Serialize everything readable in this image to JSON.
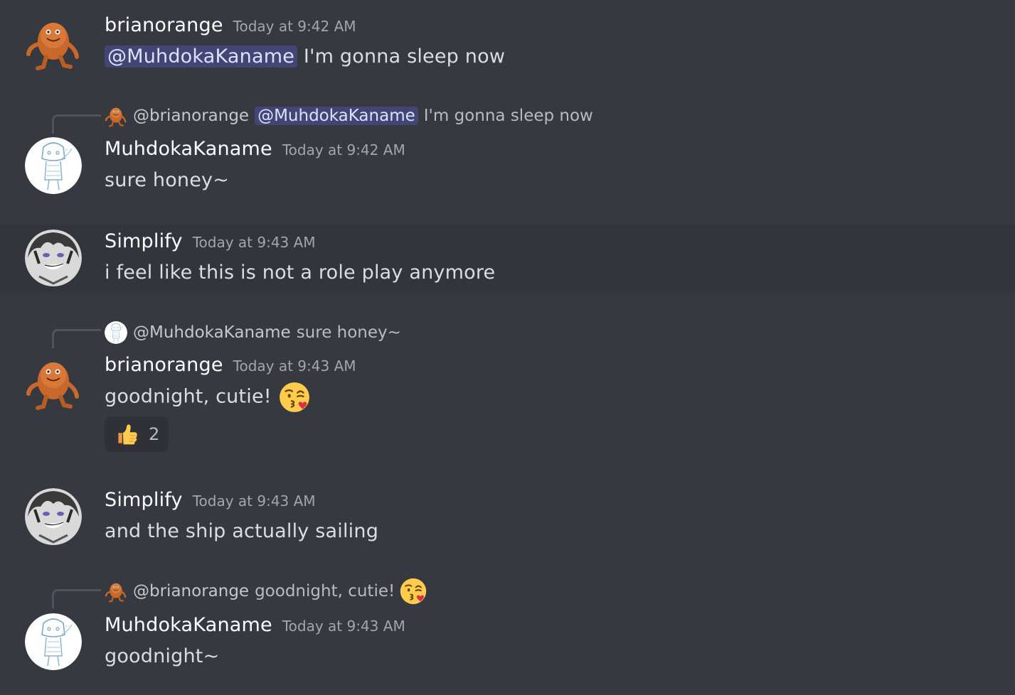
{
  "messages": [
    {
      "user": "brianorange",
      "time": "Today at 9:42 AM",
      "mention": "@MuhdokaKaname",
      "text": " I'm gonna sleep now"
    },
    {
      "reply": {
        "user": "@brianorange",
        "mention": "@MuhdokaKaname",
        "text": "I'm gonna sleep now"
      },
      "user": "MuhdokaKaname",
      "time": "Today at 9:42 AM",
      "text": "sure honey~"
    },
    {
      "user": "Simplify",
      "time": "Today at 9:43 AM",
      "text": "i feel like this is not a role play anymore"
    },
    {
      "reply": {
        "user": "@MuhdokaKaname",
        "text": "sure honey~"
      },
      "user": "brianorange",
      "time": "Today at 9:43 AM",
      "text": "goodnight, cutie!",
      "emoji": "kissing-face-emoji",
      "reaction": {
        "emoji": "thumbs-up-emoji",
        "count": "2"
      }
    },
    {
      "user": "Simplify",
      "time": "Today at 9:43 AM",
      "text": "and the ship actually sailing"
    },
    {
      "reply": {
        "user": "@brianorange",
        "text": "goodnight, cutie!",
        "emoji": "kissing-face-emoji"
      },
      "user": "MuhdokaKaname",
      "time": "Today at 9:43 AM",
      "text": "goodnight~"
    }
  ],
  "colors": {
    "background": "#36393f",
    "hover_background": "#32353b",
    "mention_background": "#414675",
    "mention_text": "#dee0fc",
    "username": "#ffffff",
    "timestamp": "#a3a6aa"
  }
}
